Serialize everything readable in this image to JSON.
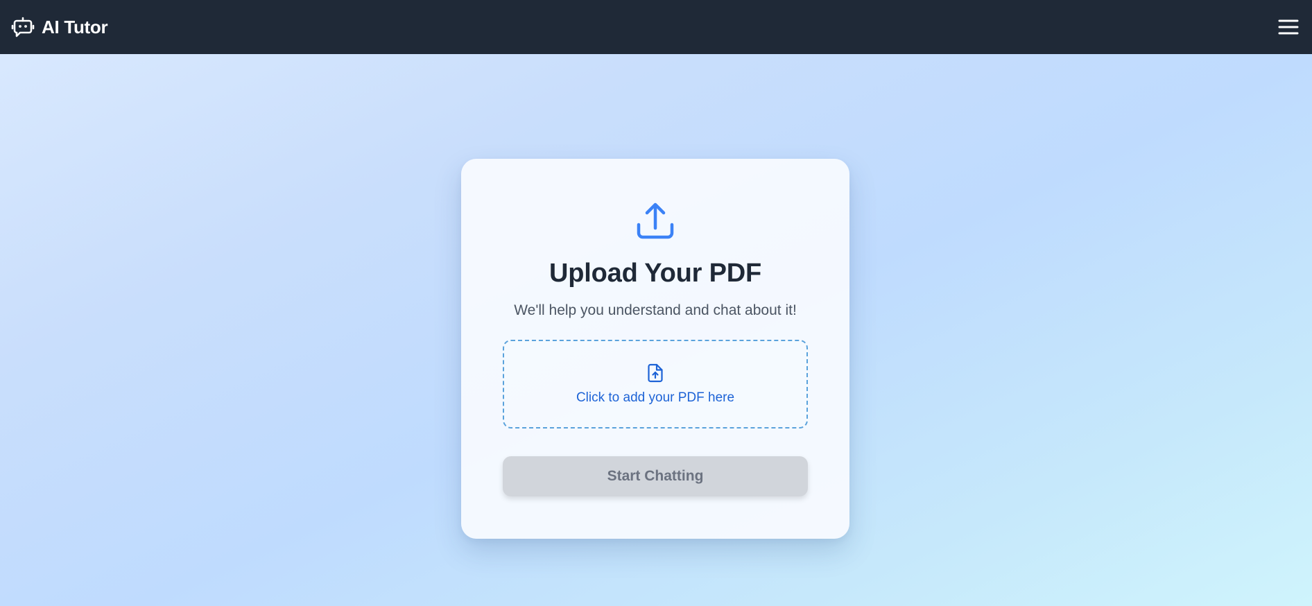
{
  "navbar": {
    "brand_icon": "robot-chat-icon",
    "title": "AI Tutor",
    "menu_icon": "hamburger-menu-icon"
  },
  "upload_card": {
    "icon": "upload-icon",
    "title": "Upload Your PDF",
    "subtitle": "We'll help you understand and chat about it!",
    "dropzone": {
      "icon": "file-upload-icon",
      "label": "Click to add your PDF here"
    },
    "start_button": {
      "label": "Start Chatting",
      "disabled": true
    }
  },
  "colors": {
    "navbar_bg": "#1f2937",
    "accent_blue": "#3b82f6",
    "link_blue": "#1d63d6",
    "dropzone_border": "#5aa2dc",
    "disabled_button_bg": "#d1d5db",
    "disabled_button_text": "#6b7280"
  }
}
